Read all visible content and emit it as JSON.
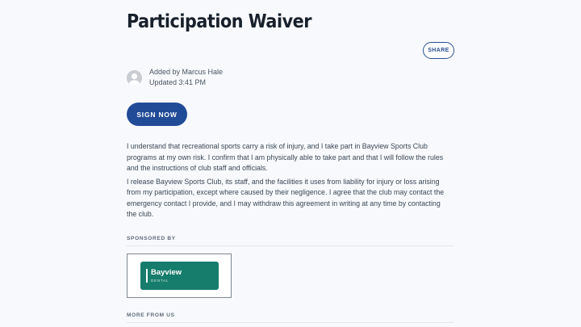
{
  "header": {
    "title": "Participation Waiver",
    "share_label": "SHARE"
  },
  "meta": {
    "added_by": "Added by Marcus Hale",
    "updated": "Updated 3:41 PM"
  },
  "actions": {
    "sign_label": "SIGN NOW"
  },
  "content": {
    "paragraphs": [
      "I understand that recreational sports carry a risk of injury, and I take part in Bayview Sports Club programs at my own risk. I confirm that I am physically able to take part and that I will follow the rules and the instructions of club staff and officials.",
      "I release Bayview Sports Club, its staff, and the facilities it uses from liability for injury or loss arising from my participation, except where caused by their negligence. I agree that the club may contact the emergency contact I provide, and I may withdraw this agreement in writing at any time by contacting the club."
    ]
  },
  "sponsor": {
    "label": "SPONSORED BY",
    "logo_name": "Bayview",
    "logo_sub": "DENTAL",
    "brand_color": "#167c6b"
  },
  "more": {
    "label": "MORE FROM US"
  },
  "colors": {
    "accent": "#214b97",
    "background": "#f7f9fc"
  },
  "icons": {
    "avatar": "user-avatar-icon"
  }
}
